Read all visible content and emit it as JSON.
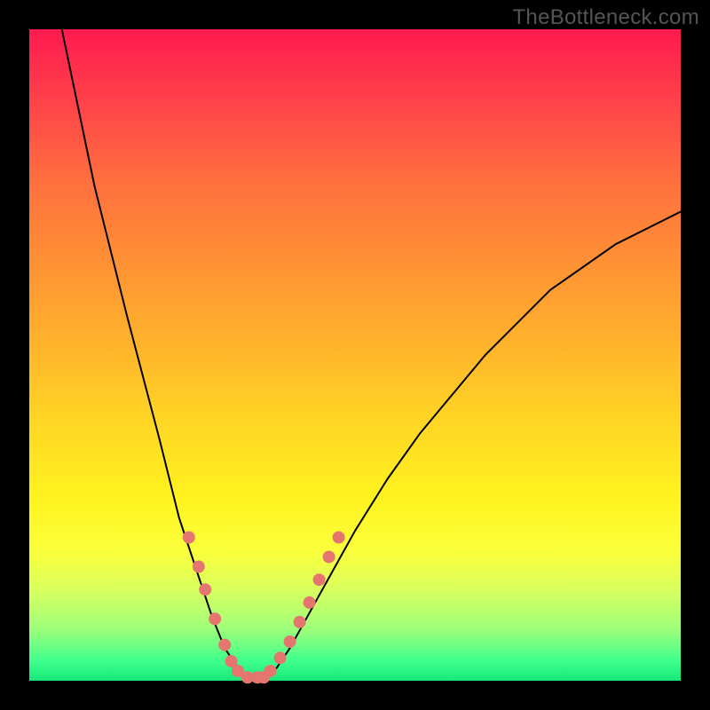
{
  "watermark": "TheBottleneck.com",
  "chart_data": {
    "type": "line",
    "title": "",
    "xlabel": "",
    "ylabel": "",
    "xlim": [
      0,
      100
    ],
    "ylim": [
      0,
      100
    ],
    "series": [
      {
        "name": "bottleneck-curve",
        "x": [
          5,
          10,
          15,
          20,
          23,
          26,
          28,
          30,
          32,
          34,
          36,
          38,
          40,
          45,
          50,
          55,
          60,
          70,
          80,
          90,
          100
        ],
        "values": [
          100,
          76,
          56,
          37,
          25,
          16,
          10,
          5,
          2,
          0,
          0,
          2,
          5,
          14,
          23,
          31,
          38,
          50,
          60,
          67,
          72
        ]
      }
    ],
    "markers": {
      "name": "dotted-highlight",
      "color": "#e5766f",
      "x": [
        24.5,
        26,
        27,
        28.5,
        30,
        31,
        32,
        33.5,
        35,
        36,
        37,
        38.5,
        40,
        41.5,
        43,
        44.5,
        46,
        47.5
      ],
      "values": [
        22,
        17.5,
        14,
        9.5,
        5.5,
        3,
        1.5,
        0.5,
        0.5,
        0.5,
        1.5,
        3.5,
        6,
        9,
        12,
        15.5,
        19,
        22
      ]
    },
    "background_gradient": {
      "top": "#ff1a4f",
      "middle": "#ffe022",
      "bottom": "#17e87a"
    }
  }
}
